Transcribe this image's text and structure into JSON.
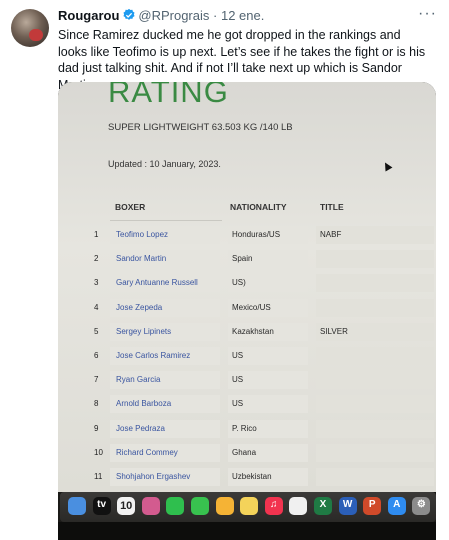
{
  "tweet": {
    "display_name": "Rougarou",
    "handle": "@RPrograis",
    "separator": "·",
    "date": "12 ene.",
    "more_glyph": "···",
    "text": "Since Ramirez ducked me he got dropped in the rankings and looks like Teofimo is up next. Let’s see if he takes the fight or is his dad just talking shit. And if not I’ll take next up which is Sandor Martin"
  },
  "photo": {
    "heading": "RATING",
    "subtitle": "SUPER LIGHTWEIGHT 63.503 KG /140 LB",
    "updated": "Updated : 10 January, 2023.",
    "columns": [
      "BOXER",
      "NATIONALITY",
      "TITLE"
    ],
    "rows": [
      {
        "num": "1",
        "boxer": "Teofimo Lopez",
        "nationality": "Honduras/US",
        "title": "NABF"
      },
      {
        "num": "2",
        "boxer": "Sandor Martin",
        "nationality": "Spain",
        "title": ""
      },
      {
        "num": "3",
        "boxer": "Gary Antuanne Russell",
        "nationality": "US)",
        "title": ""
      },
      {
        "num": "4",
        "boxer": "Jose Zepeda",
        "nationality": "Mexico/US",
        "title": ""
      },
      {
        "num": "5",
        "boxer": "Sergey Lipinets",
        "nationality": "Kazakhstan",
        "title": "SILVER"
      },
      {
        "num": "6",
        "boxer": "Jose Carlos Ramirez",
        "nationality": "US",
        "title": ""
      },
      {
        "num": "7",
        "boxer": "Ryan Garcia",
        "nationality": "US",
        "title": ""
      },
      {
        "num": "8",
        "boxer": "Arnold Barboza",
        "nationality": "US",
        "title": ""
      },
      {
        "num": "9",
        "boxer": "Jose Pedraza",
        "nationality": "P. Rico",
        "title": ""
      },
      {
        "num": "10",
        "boxer": "Richard Commey",
        "nationality": "Ghana",
        "title": ""
      },
      {
        "num": "11",
        "boxer": "Shohjahon Ergashev",
        "nationality": "Uzbekistan",
        "title": ""
      }
    ],
    "dock": {
      "calendar_day": "10",
      "apps": [
        {
          "name": "finder-icon",
          "color": "#4a8fe0",
          "glyph": ""
        },
        {
          "name": "apple-tv-icon",
          "color": "#111111",
          "glyph": "tv"
        },
        {
          "name": "calendar-icon",
          "color": "#f2f2f2",
          "glyph": ""
        },
        {
          "name": "launchpad-icon",
          "color": "#d35b8f",
          "glyph": ""
        },
        {
          "name": "facetime-icon",
          "color": "#2fbf4e",
          "glyph": ""
        },
        {
          "name": "messages-icon",
          "color": "#38c24f",
          "glyph": ""
        },
        {
          "name": "photos-icon",
          "color": "#f5b335",
          "glyph": ""
        },
        {
          "name": "notes-icon",
          "color": "#f4d35a",
          "glyph": ""
        },
        {
          "name": "music-icon",
          "color": "#f2334f",
          "glyph": "♫"
        },
        {
          "name": "reminders-icon",
          "color": "#f0f0f0",
          "glyph": ""
        },
        {
          "name": "excel-icon",
          "color": "#1f7a44",
          "glyph": "X"
        },
        {
          "name": "word-icon",
          "color": "#2b5fb8",
          "glyph": "W"
        },
        {
          "name": "powerpoint-icon",
          "color": "#d04a2a",
          "glyph": "P"
        },
        {
          "name": "app-store-icon",
          "color": "#2f8cf0",
          "glyph": "A"
        },
        {
          "name": "system-settings-icon",
          "color": "#8c8c8c",
          "glyph": "⚙"
        }
      ]
    }
  }
}
